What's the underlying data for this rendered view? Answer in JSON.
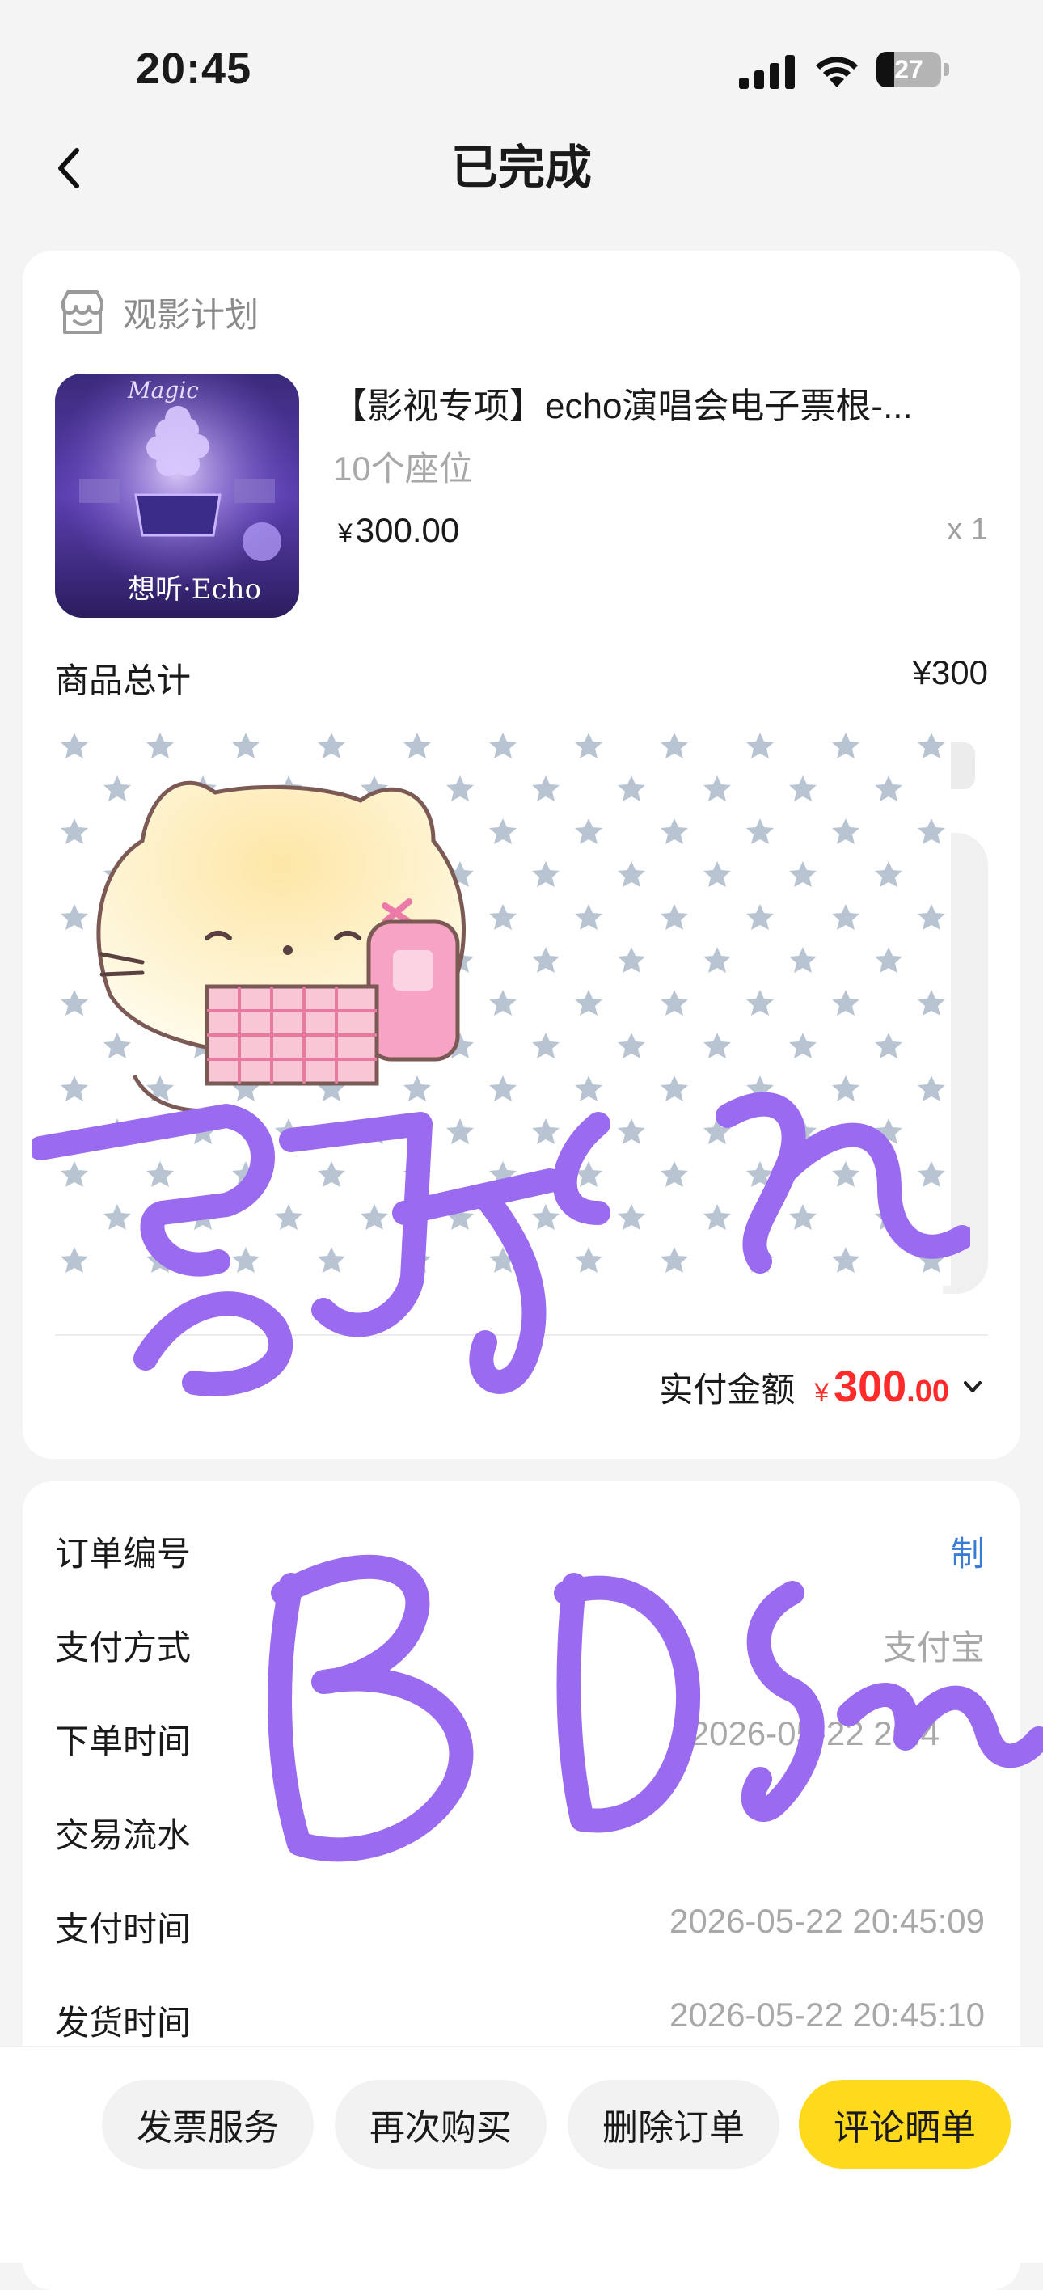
{
  "status_bar": {
    "time": "20:45",
    "battery": "27",
    "battery_level_percent": 27
  },
  "nav": {
    "title": "已完成",
    "back_icon": "chevron-left-icon"
  },
  "product_section": {
    "header": "观影计划",
    "header_icon": "store-icon",
    "product": {
      "title": "【影视专项】echo演唱会电子票根-...",
      "spec": "10个座位",
      "currency": "¥",
      "price": "300.00",
      "quantity": "x 1",
      "image_caption": "想听·Echo",
      "image_brand": "Magic"
    },
    "subtotal_label": "商品总计",
    "subtotal_value": "¥300",
    "paid_label": "实付金额",
    "paid_currency": "¥",
    "paid_int": "300",
    "paid_dec": ".00"
  },
  "order_info": {
    "rows": [
      {
        "label": "订单编号",
        "value": "制"
      },
      {
        "label": "支付方式",
        "value": "支付宝"
      },
      {
        "label": "下单时间",
        "value": "2026-05-22 20:4"
      },
      {
        "label": "交易流水",
        "value": ""
      },
      {
        "label": "支付时间",
        "value": "2026-05-22 20:45:09"
      },
      {
        "label": "发货时间",
        "value": "2026-05-22 20:45:10"
      }
    ]
  },
  "bottom_bar": {
    "invoice": "发票服务",
    "rebuy": "再次购买",
    "delete": "删除订单",
    "review": "评论晒单"
  },
  "colors": {
    "accent_yellow": "#ffd91c",
    "price_red": "#ff2a2a",
    "link_blue": "#3a7bd5",
    "scribble_purple": "#9a6bf0"
  }
}
